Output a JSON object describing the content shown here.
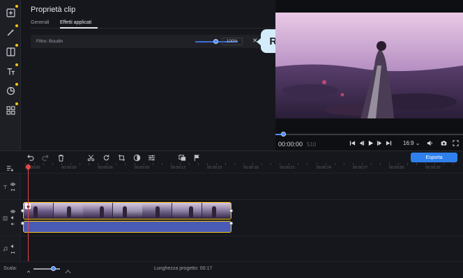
{
  "properties": {
    "title": "Proprietà clip",
    "tabs": [
      {
        "label": "Generali",
        "active": false
      },
      {
        "label": "Effetti applicati",
        "active": true
      }
    ],
    "filter": {
      "label": "Filtro: Boudin",
      "intensity_value": "100%",
      "intensity_level": 1.0,
      "remove_symbol": "✕"
    },
    "tooltip": "Rimuovi"
  },
  "rail": {
    "items": [
      {
        "icon": "import-icon",
        "dot": true
      },
      {
        "icon": "magic-wand-icon",
        "dot": true
      },
      {
        "icon": "transitions-icon",
        "dot": true
      },
      {
        "icon": "titles-icon",
        "dot": true
      },
      {
        "icon": "stickers-icon",
        "dot": true
      },
      {
        "icon": "more-tools-icon",
        "dot": true
      }
    ]
  },
  "player": {
    "current_time": "00:00:00",
    "duration_hint": "510",
    "aspect_ratio": "16:9 ⌄",
    "progress": 0.02
  },
  "toolbar": {
    "export_label": "Esporta"
  },
  "timeline": {
    "ruler_labels": [
      "00:00:00",
      "00:00:03",
      "00:00:06",
      "00:00:09",
      "00:00:12",
      "00:00:15",
      "00:00:18",
      "00:00:21",
      "00:00:24",
      "00:00:27",
      "00:00:30",
      "00:00:33"
    ]
  },
  "status": {
    "scale_label": "Scala:",
    "project_length": "Lunghezza progetto: 00:17",
    "zoom_level": 0.7
  },
  "colors": {
    "accent": "#2f80ed",
    "selection": "#f5c518",
    "playhead": "#e04646",
    "audio_clip": "#4a5bb5",
    "tooltip_bg": "#d4ecfa"
  }
}
